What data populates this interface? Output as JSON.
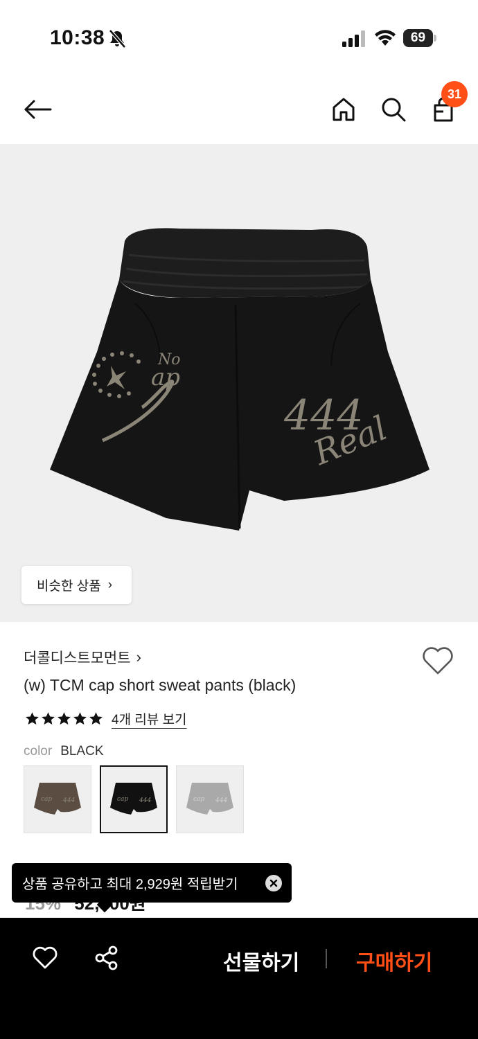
{
  "status_bar": {
    "time": "10:38",
    "battery": "69",
    "icons": [
      "bell-slash-icon",
      "signal-icon",
      "wifi-icon",
      "battery-icon"
    ]
  },
  "nav": {
    "icons": [
      "back-arrow-icon",
      "home-icon",
      "search-icon",
      "cart-icon"
    ],
    "cart_count": "31"
  },
  "hero": {
    "similar_label": "비슷한 상품",
    "similar_chevron": "›"
  },
  "product": {
    "brand": "더콜디스트모먼트",
    "brand_chevron": "›",
    "title": "(w) TCM cap short sweat pants (black)",
    "rating": 5,
    "review_link": "4개 리뷰 보기",
    "color_label": "color",
    "color_value": "BLACK",
    "swatches": [
      {
        "color": "#5b4d42",
        "selected": false
      },
      {
        "color": "#111111",
        "selected": true
      },
      {
        "color": "#a9a9a9",
        "selected": false
      }
    ],
    "price_discount": "15%",
    "price": "52,400원"
  },
  "toast": {
    "message": "상품 공유하고 최대 2,929원 적립받기"
  },
  "bottom_bar": {
    "gift_label": "선물하기",
    "buy_label": "구매하기",
    "accent": "#ff4f17",
    "icons": [
      "heart-icon",
      "share-icon"
    ]
  }
}
